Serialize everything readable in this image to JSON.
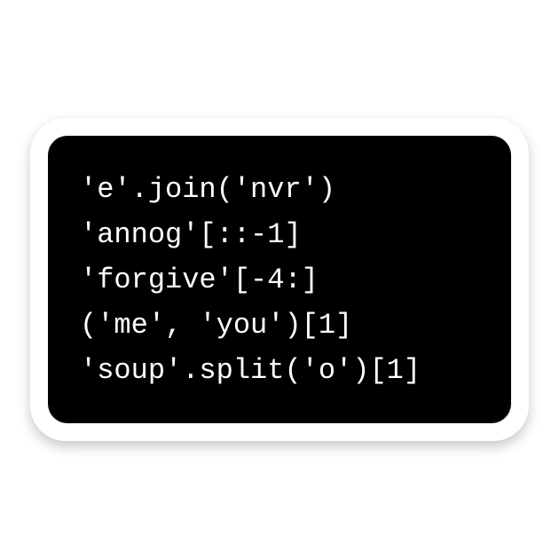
{
  "code": {
    "lines": [
      "'e'.join('nvr')",
      "'annog'[::-1]",
      "'forgive'[-4:]",
      "('me', 'you')[1]",
      "'soup'.split('o')[1]"
    ]
  }
}
